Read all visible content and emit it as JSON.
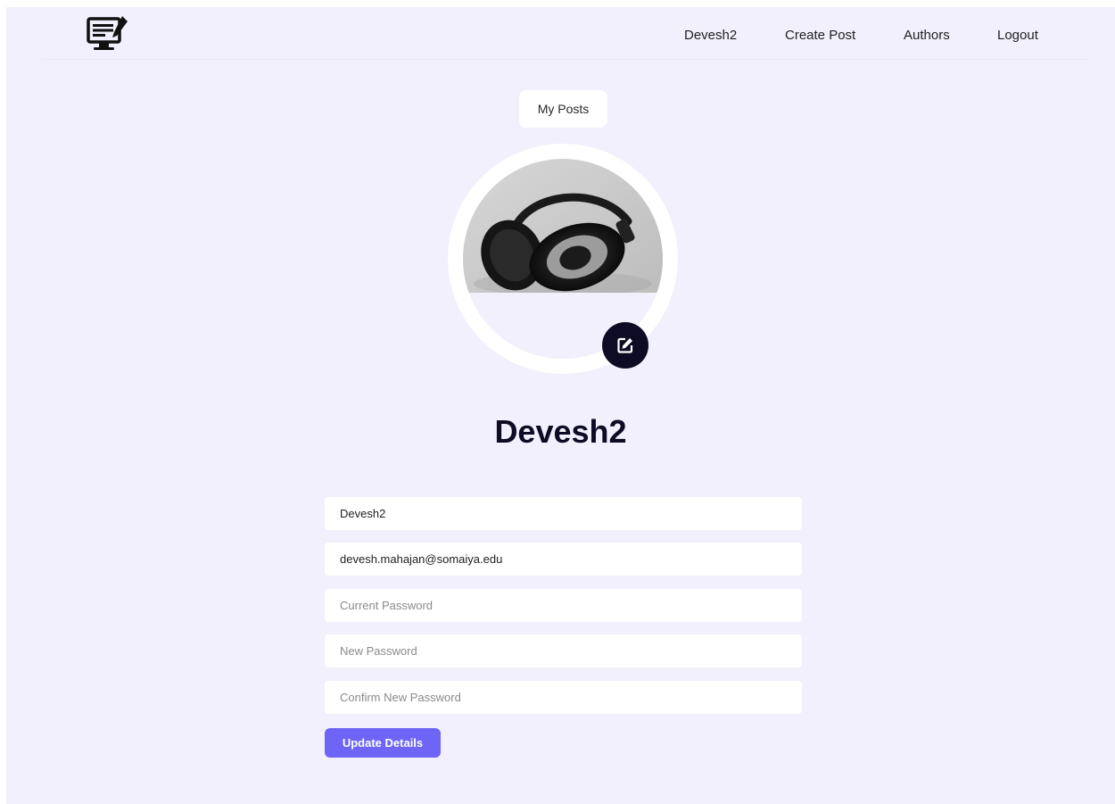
{
  "nav": {
    "logo_icon": "monitor-edit-icon",
    "links": [
      {
        "label": "Devesh2"
      },
      {
        "label": "Create Post"
      },
      {
        "label": "Authors"
      },
      {
        "label": "Logout"
      }
    ]
  },
  "my_posts_label": "My Posts",
  "avatar": {
    "image": "headphones-photo",
    "edit_icon": "edit-icon"
  },
  "profile": {
    "username": "Devesh2"
  },
  "form": {
    "name_value": "Devesh2",
    "email_value": "devesh.mahajan@somaiya.edu",
    "current_password_placeholder": "Current Password",
    "new_password_placeholder": "New Password",
    "confirm_password_placeholder": "Confirm New Password",
    "submit_label": "Update Details"
  },
  "colors": {
    "page_background": "#f1f0fc",
    "accent": "#6e64f5",
    "dark": "#0e0c24"
  }
}
